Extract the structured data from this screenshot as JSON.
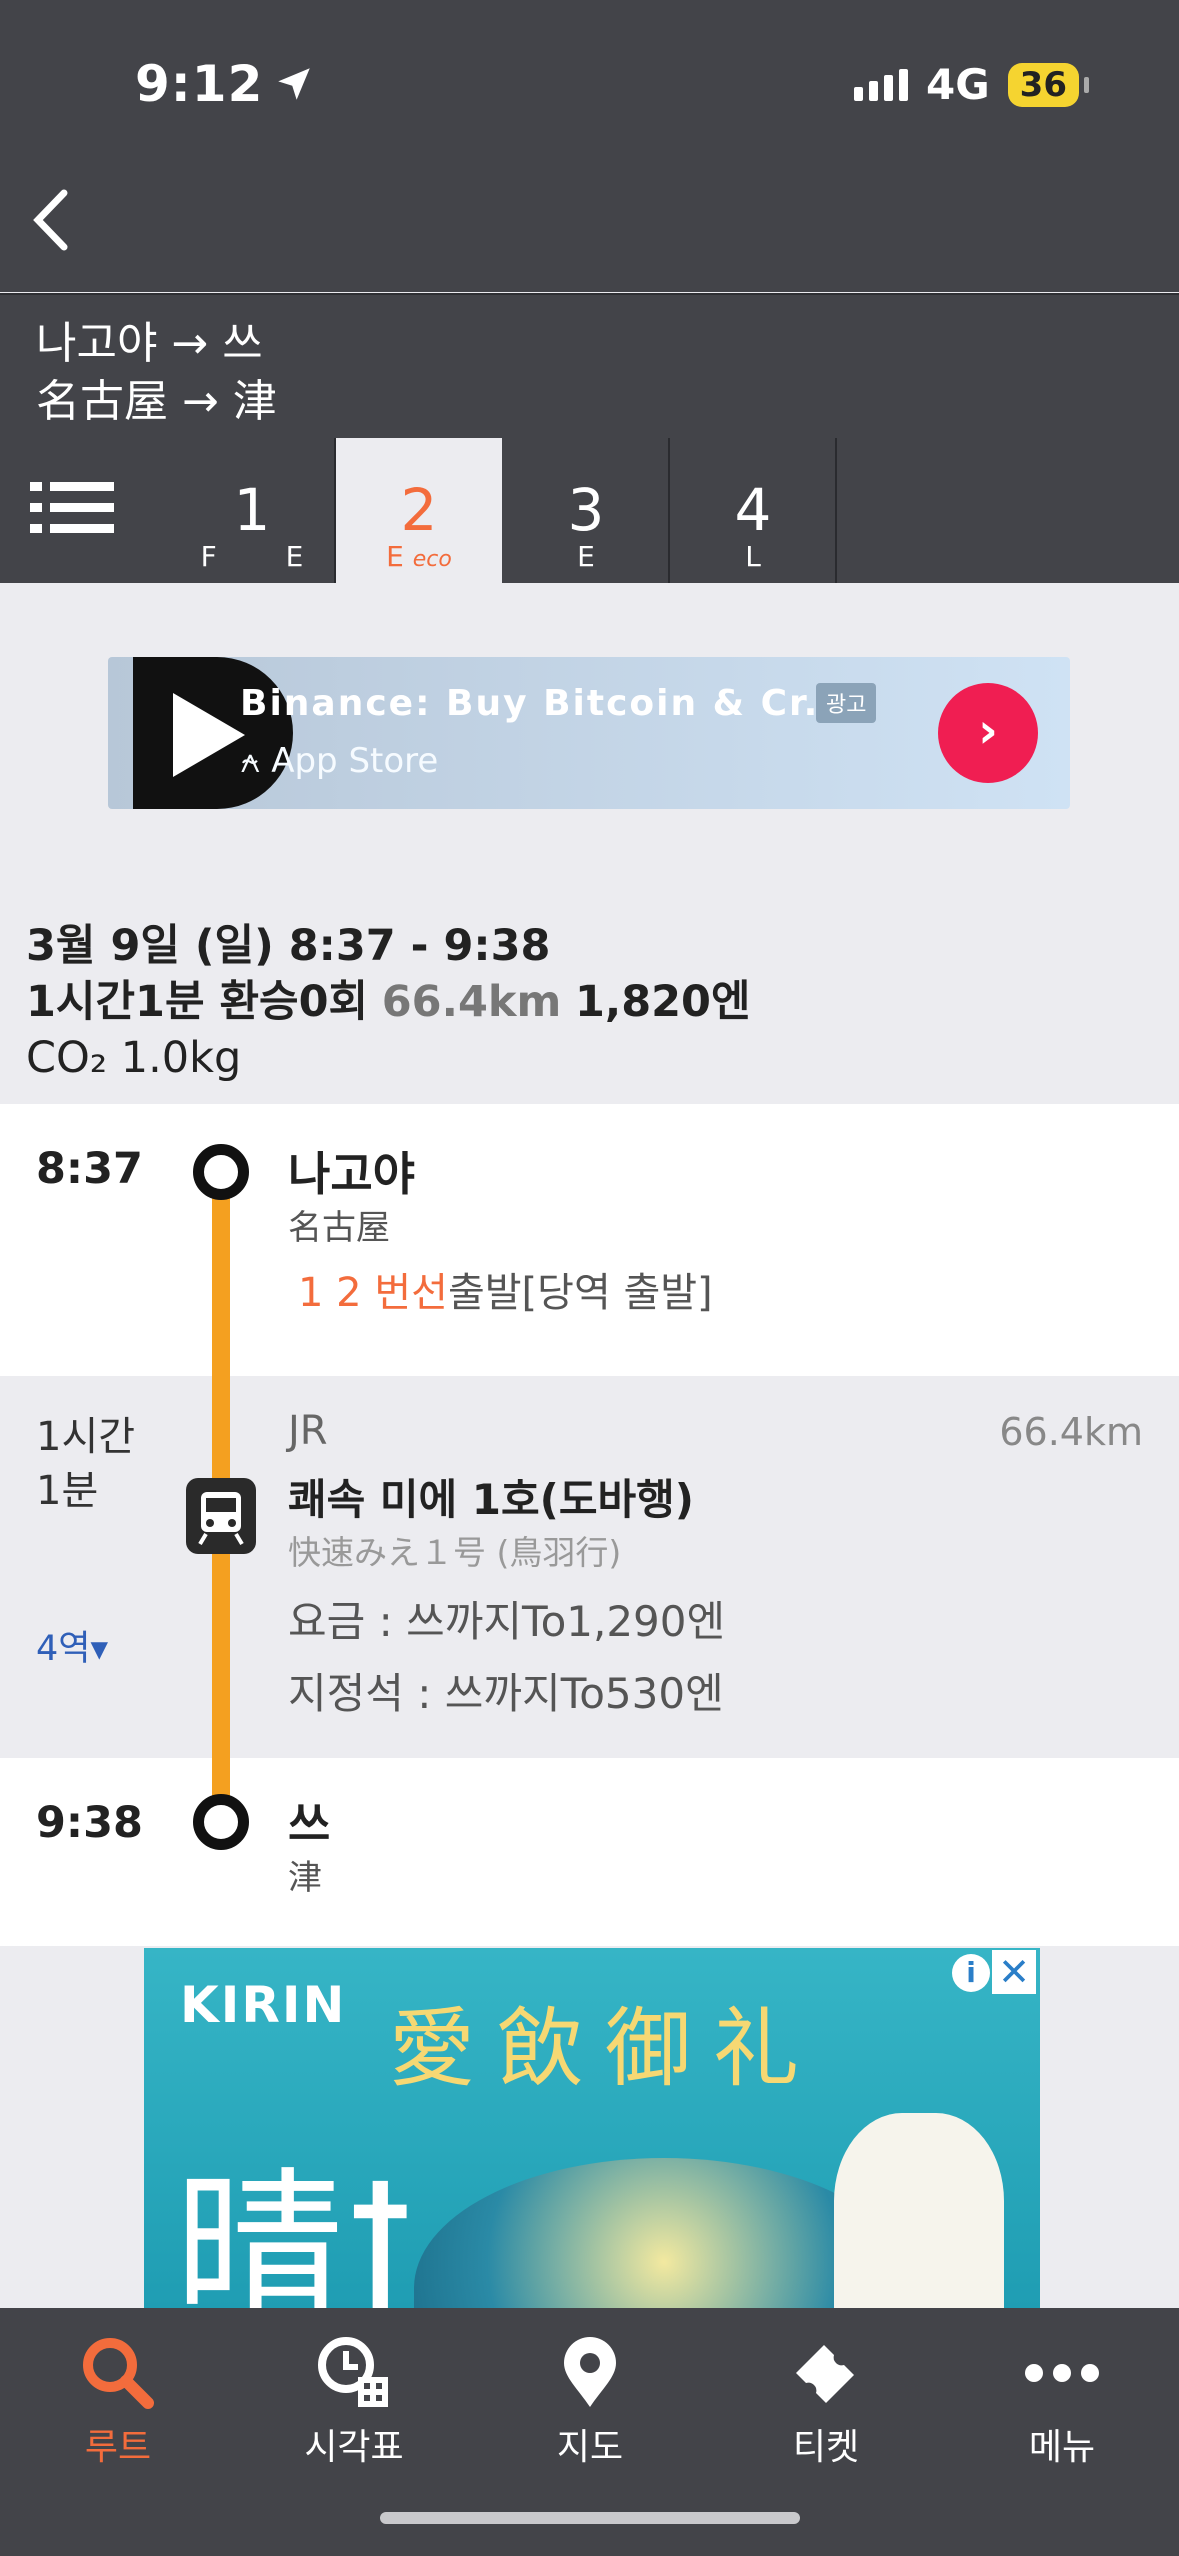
{
  "status": {
    "time": "9:12",
    "network": "4G",
    "battery": "36"
  },
  "route": {
    "title_kr": "나고야 → 쓰",
    "title_jp": "名古屋 → 津"
  },
  "tabs": [
    {
      "num": "1",
      "sub": "F E"
    },
    {
      "num": "2",
      "sub": "E",
      "eco": "eco"
    },
    {
      "num": "3",
      "sub": "E"
    },
    {
      "num": "4",
      "sub": "L"
    }
  ],
  "ad_top": {
    "title": "Binance: Buy Bitcoin & Cr...",
    "store": "App Store",
    "badge": "광고"
  },
  "summary": {
    "date_time": "3월 9일 (일)  8:37 -  9:38",
    "duration_transfer": "1시간1분 환승0회",
    "distance": "66.4km",
    "fare": "1,820엔",
    "co2": "CO₂ 1.0kg"
  },
  "departure": {
    "time": "8:37",
    "name_kr": "나고야",
    "name_jp": "名古屋",
    "platform_hl": "1 2 번선",
    "platform_text": "출발[당역 출발]"
  },
  "segment": {
    "duration_line1": "1시간",
    "duration_line2": "1분",
    "stations": "4역▾",
    "line": "JR",
    "distance": "66.4km",
    "train_kr": "쾌속 미에 1호(도바행)",
    "train_jp": "快速みえ１号 (鳥羽行)",
    "fare": "요금 : 쓰까지To1,290엔",
    "reserved": "지정석 : 쓰까지To530엔"
  },
  "arrival": {
    "time": "9:38",
    "name_kr": "쓰",
    "name_jp": "津"
  },
  "ad_bottom": {
    "brand": "KIRIN",
    "slogan": "愛飲御礼",
    "big": "晴ꝉ"
  },
  "nav": [
    {
      "label": "루트",
      "icon": "search-icon"
    },
    {
      "label": "시각표",
      "icon": "timetable-icon"
    },
    {
      "label": "지도",
      "icon": "map-pin-icon"
    },
    {
      "label": "티켓",
      "icon": "ticket-icon"
    },
    {
      "label": "메뉴",
      "icon": "more-icon"
    }
  ],
  "colors": {
    "accent": "#f36c3c",
    "header": "#434449",
    "route_line": "#f4a020",
    "link": "#2f5fb8"
  }
}
